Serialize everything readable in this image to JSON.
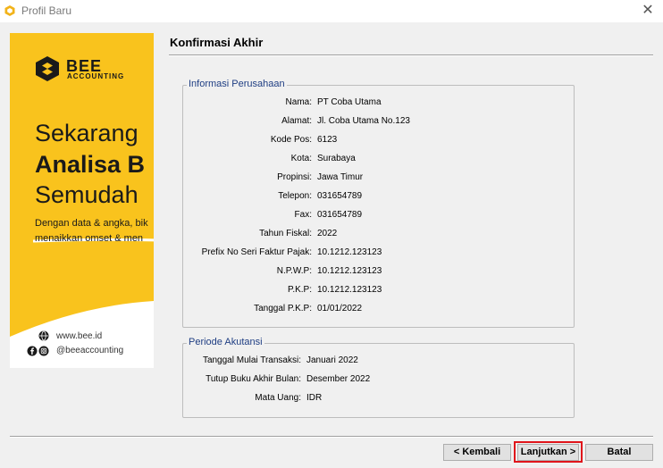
{
  "window": {
    "title": "Profil Baru",
    "icon": "bee-app-icon",
    "close_icon": "close-icon"
  },
  "banner": {
    "brand_top": "BEE",
    "brand_bottom": "ACCOUNTING",
    "headline_1": "Sekarang",
    "headline_2": "Analisa B",
    "headline_3": "Semudah",
    "desc_1": "Dengan data & angka, bik",
    "desc_2": "menaikkan omset & men",
    "website": "www.bee.id",
    "social": "@beeaccounting",
    "accent_color": "#f9c31d"
  },
  "page": {
    "title": "Konfirmasi Akhir"
  },
  "company": {
    "legend": "Informasi Perusahaan",
    "rows": [
      {
        "label": "Nama:",
        "value": "PT Coba Utama"
      },
      {
        "label": "Alamat:",
        "value": "Jl. Coba Utama No.123"
      },
      {
        "label": "Kode Pos:",
        "value": "6123"
      },
      {
        "label": "Kota:",
        "value": "Surabaya"
      },
      {
        "label": "Propinsi:",
        "value": "Jawa Timur"
      },
      {
        "label": "Telepon:",
        "value": "031654789"
      },
      {
        "label": "Fax:",
        "value": "031654789"
      },
      {
        "label": "Tahun Fiskal:",
        "value": "2022"
      },
      {
        "label": "Prefix No Seri Faktur Pajak:",
        "value": "10.1212.123123"
      },
      {
        "label": "N.P.W.P:",
        "value": "10.1212.123123"
      },
      {
        "label": "P.K.P:",
        "value": "10.1212.123123"
      },
      {
        "label": "Tanggal P.K.P:",
        "value": "01/01/2022"
      }
    ]
  },
  "period": {
    "legend": "Periode Akutansi",
    "rows": [
      {
        "label": "Tanggal Mulai Transaksi:",
        "value": "Januari 2022"
      },
      {
        "label": "Tutup Buku Akhir Bulan:",
        "value": "Desember 2022"
      },
      {
        "label": "Mata Uang:",
        "value": "IDR"
      }
    ]
  },
  "buttons": {
    "back": "< Kembali",
    "next": "Lanjutkan >",
    "cancel": "Batal",
    "highlight_color": "#e0151b"
  }
}
